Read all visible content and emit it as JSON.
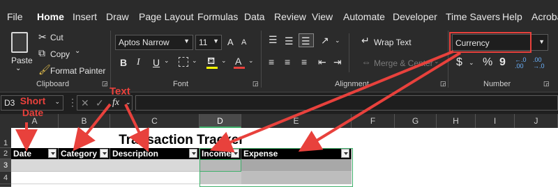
{
  "menu": {
    "items": [
      "File",
      "Home",
      "Insert",
      "Draw",
      "Page Layout",
      "Formulas",
      "Data",
      "Review",
      "View",
      "Automate",
      "Developer",
      "Time Savers",
      "Help",
      "Acrobat"
    ]
  },
  "clipboard": {
    "paste": "Paste",
    "cut": "Cut",
    "copy": "Copy",
    "format_painter": "Format Painter",
    "label": "Clipboard"
  },
  "font": {
    "name": "Aptos Narrow",
    "size": "11",
    "label": "Font",
    "bold": "B",
    "italic": "I",
    "underline": "U",
    "font_color_glyph": "A",
    "grow": "A",
    "shrink": "A"
  },
  "alignment": {
    "wrap": "Wrap Text",
    "merge": "Merge & Center",
    "label": "Alignment"
  },
  "number": {
    "format": "Currency",
    "label": "Number",
    "dollar": "$",
    "percent": "%",
    "comma": "9",
    "inc_dec": "←.0 .00",
    "dec_dec": ".00 →.0"
  },
  "formula": {
    "name_box": "D3",
    "fx": "fx"
  },
  "columns": [
    "A",
    "B",
    "C",
    "D",
    "E",
    "F",
    "G",
    "H",
    "I",
    "J"
  ],
  "rows": [
    "1",
    "2",
    "3",
    "4"
  ],
  "sheet": {
    "title": "Transaction Tracker",
    "headers": [
      "Date",
      "Category",
      "Description",
      "Income",
      "Expense"
    ]
  },
  "annotations": {
    "short_date": "Short\nDate",
    "text": "Text"
  },
  "colors": {
    "accent": "#3fb06a",
    "annotation_red": "#e8413c",
    "highlight_box": "#e8413c"
  }
}
